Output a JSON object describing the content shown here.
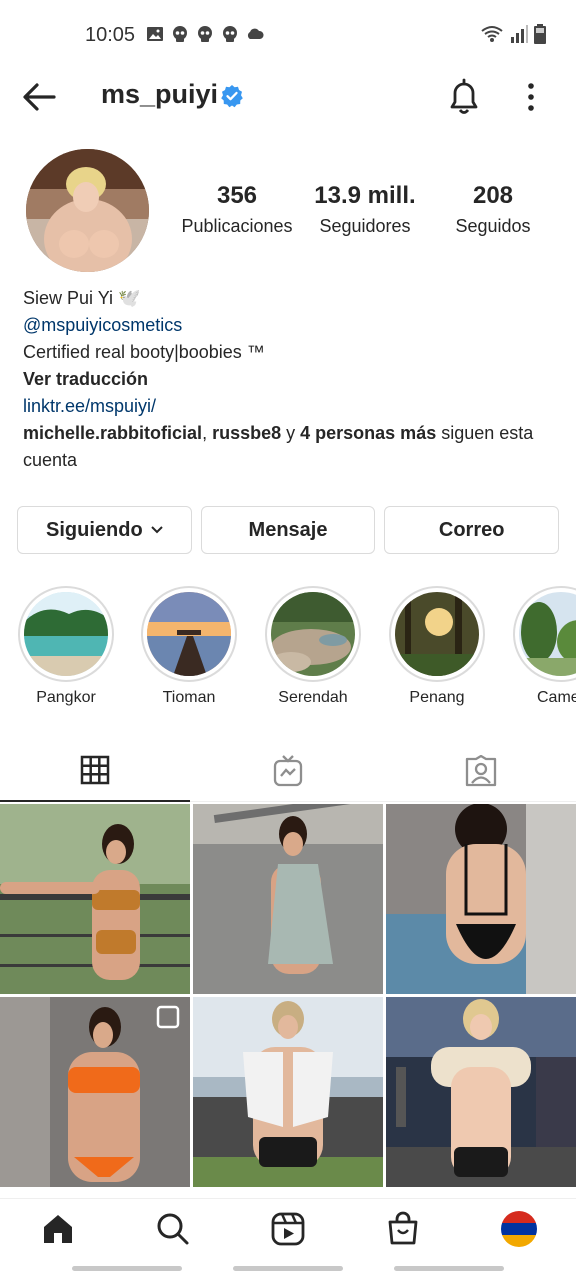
{
  "status_bar": {
    "time": "10:05"
  },
  "header": {
    "username": "ms_puiyi"
  },
  "stats": {
    "posts": {
      "value": "356",
      "label": "Publicaciones"
    },
    "followers": {
      "value": "13.9 mill.",
      "label": "Seguidores"
    },
    "following": {
      "value": "208",
      "label": "Seguidos"
    }
  },
  "bio": {
    "name": "Siew Pui Yi 🕊️",
    "mention": "@mspuiyicosmetics",
    "text": "Certified real booty|boobies ™",
    "translate": "Ver traducción",
    "link": "linktr.ee/mspuiyi/",
    "followed_by_user1": "michelle.rabbitoficial",
    "sep1": ", ",
    "followed_by_user2": "russbe8",
    "sep2": " y ",
    "followed_by_more": "4 personas más",
    "followed_by_suffix": " siguen esta cuenta"
  },
  "actions": {
    "following_label": "Siguiendo",
    "message_label": "Mensaje",
    "email_label": "Correo"
  },
  "highlights": [
    {
      "label": "Pangkor"
    },
    {
      "label": "Tioman"
    },
    {
      "label": "Serendah"
    },
    {
      "label": "Penang"
    },
    {
      "label": "Camer"
    }
  ],
  "tabs": [
    "grid-icon",
    "igtv-icon",
    "tagged-icon"
  ],
  "bottom_nav": [
    "home-icon",
    "search-icon",
    "reels-icon",
    "shop-icon",
    "profile-avatar"
  ],
  "colors": {
    "text": "#262626",
    "link": "#00376b",
    "verified": "#3897f0",
    "border": "#dbdbdb"
  }
}
